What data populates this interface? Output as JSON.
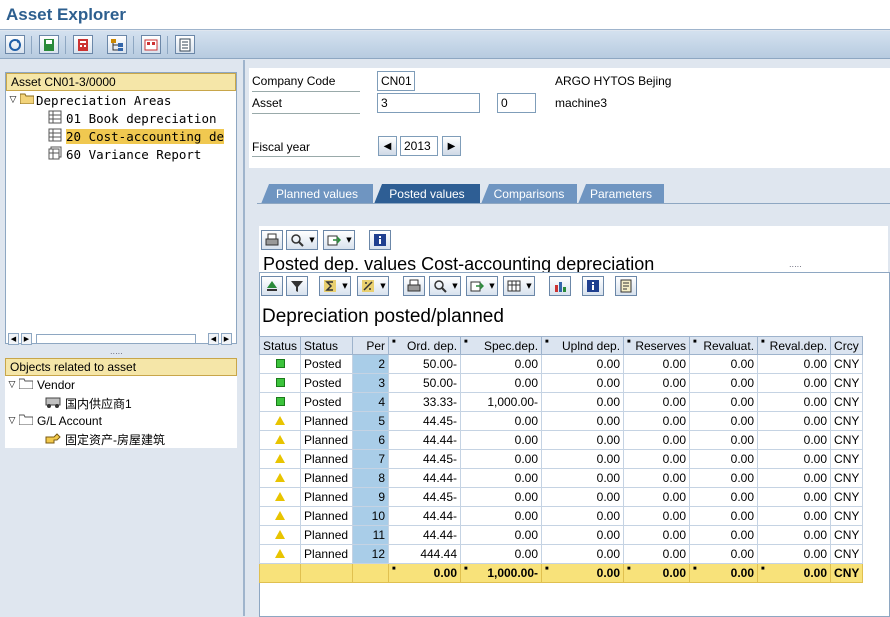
{
  "app": {
    "title": "Asset Explorer"
  },
  "toolbar": {
    "icons": [
      "refresh-icon",
      "save-icon",
      "calculator-icon",
      "hierarchy-icon",
      "compare-icon",
      "document-icon"
    ]
  },
  "asset_tree": {
    "header": "Asset CN01-3/0000",
    "root": "Depreciation Areas",
    "items": [
      {
        "label": "01 Book depreciation"
      },
      {
        "label": "20 Cost-accounting de"
      },
      {
        "label": "60 Variance Report"
      }
    ]
  },
  "objects_tree": {
    "header": "Objects related to asset",
    "groups": [
      {
        "label": "Vendor",
        "child": "国内供应商1"
      },
      {
        "label": "G/L Account",
        "child": "固定资产-房屋建筑"
      }
    ]
  },
  "form": {
    "company_code_label": "Company Code",
    "company_code": "CN01",
    "company_name": "ARGO HYTOS Bejing",
    "asset_label": "Asset",
    "asset_number": "3",
    "asset_sub": "0",
    "asset_desc": "machine3",
    "fiscal_year_label": "Fiscal year",
    "fiscal_year": "2013"
  },
  "tabs": [
    {
      "label": "Planned values"
    },
    {
      "label": "Posted values"
    },
    {
      "label": "Comparisons"
    },
    {
      "label": "Parameters"
    }
  ],
  "posted_section": {
    "title": "Posted dep. values Cost-accounting depreciation"
  },
  "grid": {
    "title": "Depreciation posted/planned",
    "columns": [
      "Status",
      "Status",
      "Per",
      "Ord. dep.",
      "Spec.dep.",
      "Uplnd dep.",
      "Reserves",
      "Revaluat.",
      "Reval.dep.",
      "Crcy"
    ],
    "rows": [
      {
        "icon": "green",
        "status": "Posted",
        "per": "2",
        "ord": "50.00-",
        "spec": "0.00",
        "uplnd": "0.00",
        "res": "0.00",
        "reval": "0.00",
        "revaldep": "0.00",
        "crcy": "CNY"
      },
      {
        "icon": "green",
        "status": "Posted",
        "per": "3",
        "ord": "50.00-",
        "spec": "0.00",
        "uplnd": "0.00",
        "res": "0.00",
        "reval": "0.00",
        "revaldep": "0.00",
        "crcy": "CNY"
      },
      {
        "icon": "green",
        "status": "Posted",
        "per": "4",
        "ord": "33.33-",
        "spec": "1,000.00-",
        "uplnd": "0.00",
        "res": "0.00",
        "reval": "0.00",
        "revaldep": "0.00",
        "crcy": "CNY"
      },
      {
        "icon": "yellow",
        "status": "Planned",
        "per": "5",
        "ord": "44.45-",
        "spec": "0.00",
        "uplnd": "0.00",
        "res": "0.00",
        "reval": "0.00",
        "revaldep": "0.00",
        "crcy": "CNY"
      },
      {
        "icon": "yellow",
        "status": "Planned",
        "per": "6",
        "ord": "44.44-",
        "spec": "0.00",
        "uplnd": "0.00",
        "res": "0.00",
        "reval": "0.00",
        "revaldep": "0.00",
        "crcy": "CNY"
      },
      {
        "icon": "yellow",
        "status": "Planned",
        "per": "7",
        "ord": "44.45-",
        "spec": "0.00",
        "uplnd": "0.00",
        "res": "0.00",
        "reval": "0.00",
        "revaldep": "0.00",
        "crcy": "CNY"
      },
      {
        "icon": "yellow",
        "status": "Planned",
        "per": "8",
        "ord": "44.44-",
        "spec": "0.00",
        "uplnd": "0.00",
        "res": "0.00",
        "reval": "0.00",
        "revaldep": "0.00",
        "crcy": "CNY"
      },
      {
        "icon": "yellow",
        "status": "Planned",
        "per": "9",
        "ord": "44.45-",
        "spec": "0.00",
        "uplnd": "0.00",
        "res": "0.00",
        "reval": "0.00",
        "revaldep": "0.00",
        "crcy": "CNY"
      },
      {
        "icon": "yellow",
        "status": "Planned",
        "per": "10",
        "ord": "44.44-",
        "spec": "0.00",
        "uplnd": "0.00",
        "res": "0.00",
        "reval": "0.00",
        "revaldep": "0.00",
        "crcy": "CNY"
      },
      {
        "icon": "yellow",
        "status": "Planned",
        "per": "11",
        "ord": "44.44-",
        "spec": "0.00",
        "uplnd": "0.00",
        "res": "0.00",
        "reval": "0.00",
        "revaldep": "0.00",
        "crcy": "CNY"
      },
      {
        "icon": "yellow",
        "status": "Planned",
        "per": "12",
        "ord": "444.44",
        "spec": "0.00",
        "uplnd": "0.00",
        "res": "0.00",
        "reval": "0.00",
        "revaldep": "0.00",
        "crcy": "CNY"
      }
    ],
    "total": {
      "ord": "0.00",
      "spec": "1,000.00-",
      "uplnd": "0.00",
      "res": "0.00",
      "reval": "0.00",
      "revaldep": "0.00",
      "crcy": "CNY"
    }
  },
  "colors": {
    "accent": "#2e5e94",
    "selection": "#f0c850",
    "total_row": "#f8e27a",
    "per_column": "#a9cde8"
  }
}
